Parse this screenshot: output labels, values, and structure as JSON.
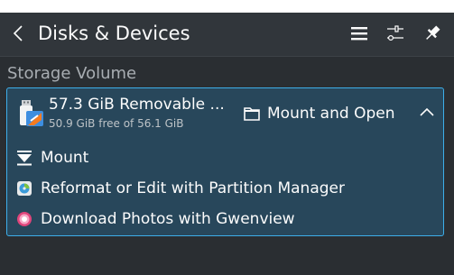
{
  "header": {
    "title": "Disks & Devices",
    "back_icon": "chevron-left-icon",
    "menu_icon": "hamburger-menu-icon",
    "configure_icon": "settings-sliders-icon",
    "pin_icon": "pin-icon"
  },
  "section": {
    "title": "Storage Volume"
  },
  "device": {
    "name": "57.3 GiB Removable ...",
    "free": "50.9 GiB free of 56.1 GiB",
    "icon": "usb-drive-icon",
    "primary_action": {
      "label": "Mount and Open",
      "icon": "folder-icon"
    },
    "collapse_icon": "chevron-up-icon",
    "actions": [
      {
        "label": "Mount",
        "icon": "mount-icon"
      },
      {
        "label": "Reformat or Edit with Partition Manager",
        "icon": "partition-manager-icon"
      },
      {
        "label": "Download Photos with Gwenview",
        "icon": "gwenview-icon"
      }
    ]
  },
  "colors": {
    "header_bg": "#31363b",
    "panel_bg": "#2a2e32",
    "card_bg": "#28475b",
    "accent": "#3daee9",
    "text": "#fcfcfc",
    "muted_text": "#a8adb2"
  }
}
